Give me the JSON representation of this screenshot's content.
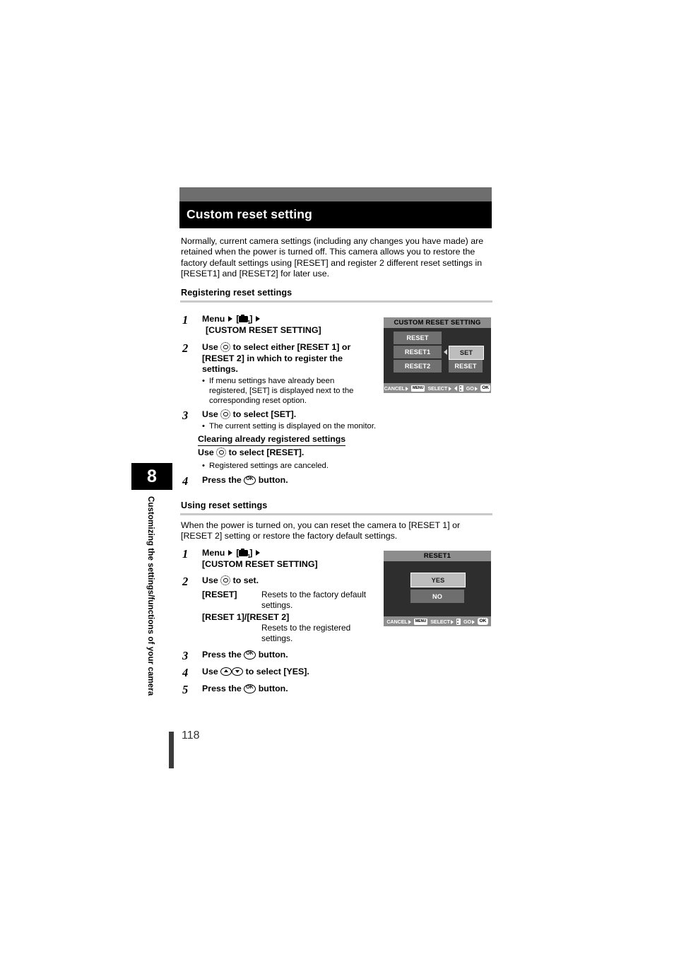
{
  "chapter": {
    "number": "8",
    "vertical_title": "Customizing the settings/functions of your camera"
  },
  "page_number": "118",
  "header": {
    "title": "Custom reset setting"
  },
  "intro": "Normally, current camera settings (including any changes you have made) are retained when the power is turned off. This camera allows you to restore the factory default settings using [RESET] and register 2 different reset settings in [RESET1] and [RESET2] for later use.",
  "sections": {
    "registering": {
      "heading": "Registering reset settings",
      "step1": {
        "num": "1",
        "line1_a": "Menu",
        "line1_b": "[",
        "line1_c": "]",
        "line2": "[CUSTOM RESET SETTING]"
      },
      "step2": {
        "num": "2",
        "text_a": "Use",
        "text_b": "to select either [RESET 1] or [RESET 2] in which to register the settings.",
        "bullet": "If menu settings have already been registered, [SET] is displayed next to the corresponding reset option."
      },
      "step3": {
        "num": "3",
        "text_a": "Use",
        "text_b": "to select [SET].",
        "bullet": "The current setting is displayed on the monitor.",
        "sub_heading": "Clearing already registered settings",
        "sub_text_a": "Use",
        "sub_text_b": "to select [RESET].",
        "sub_bullet": "Registered settings are canceled."
      },
      "step4": {
        "num": "4",
        "text_a": "Press the",
        "text_b": "button."
      }
    },
    "using": {
      "heading": "Using reset settings",
      "intro": "When the power is turned on, you can reset the camera to [RESET 1]  or [RESET 2] setting or restore the factory default settings.",
      "step1": {
        "num": "1",
        "line1_a": "Menu",
        "line1_b": "[",
        "line1_c": "]",
        "line2": "[CUSTOM RESET SETTING]"
      },
      "step2": {
        "num": "2",
        "text_a": "Use",
        "text_b": "to set.",
        "rows": [
          {
            "term": "[RESET]",
            "desc": "Resets to the factory default settings."
          },
          {
            "term": "[RESET 1]/[RESET 2]",
            "desc": "Resets to the registered settings."
          }
        ]
      },
      "step3": {
        "num": "3",
        "text_a": "Press the",
        "text_b": "button."
      },
      "step4": {
        "num": "4",
        "text_a": "Use",
        "text_b": "to select [YES]."
      },
      "step5": {
        "num": "5",
        "text_a": "Press the",
        "text_b": "button."
      }
    }
  },
  "lcd_custom_reset": {
    "title": "CUSTOM RESET SETTING",
    "items": [
      {
        "label": "RESET",
        "value": ""
      },
      {
        "label": "RESET1",
        "value": "SET"
      },
      {
        "label": "RESET2",
        "value": "RESET"
      }
    ],
    "footer": {
      "cancel_label": "CANCEL",
      "cancel_key": "MENU",
      "select_label": "SELECT",
      "select_key": "",
      "go_label": "GO",
      "go_key": "OK"
    }
  },
  "lcd_reset1": {
    "title": "RESET1",
    "options": [
      {
        "label": "YES",
        "selected": true
      },
      {
        "label": "NO",
        "selected": false
      }
    ],
    "footer": {
      "cancel_label": "CANCEL",
      "cancel_key": "MENU",
      "select_label": "SELECT",
      "go_label": "GO",
      "go_key": "OK"
    }
  },
  "colors": {
    "header_gray": "#6e6e6e",
    "header_black": "#000000",
    "rule_gray": "#c9c9c9",
    "lcd_bg": "#2e2e2e",
    "lcd_bar": "#8d8d8d",
    "lcd_option": "#707070",
    "lcd_selected": "#bdbdbd"
  }
}
